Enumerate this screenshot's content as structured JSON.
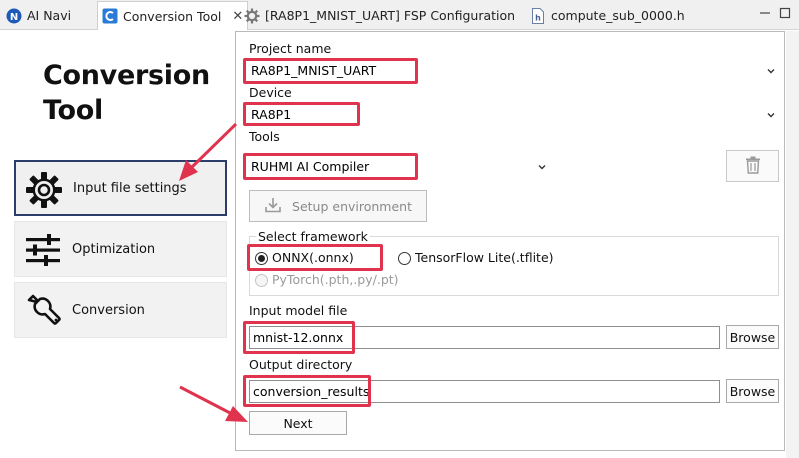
{
  "tabs": [
    {
      "label": "AI Navi",
      "icon": "ai-navi-icon"
    },
    {
      "label": "Conversion Tool",
      "icon": "conversion-tool-icon",
      "active": true
    },
    {
      "label": "[RA8P1_MNIST_UART] FSP Configuration",
      "icon": "gear-icon"
    },
    {
      "label": "compute_sub_0000.h",
      "icon": "header-file-icon"
    }
  ],
  "sidebar": {
    "title_line1": "Conversion",
    "title_line2": "Tool",
    "items": [
      {
        "label": "Input file settings",
        "icon": "gear-icon",
        "selected": true
      },
      {
        "label": "Optimization",
        "icon": "sliders-icon"
      },
      {
        "label": "Conversion",
        "icon": "wrench-icon"
      }
    ]
  },
  "form": {
    "project_name_label": "Project name",
    "project_name_value": "RA8P1_MNIST_UART",
    "device_label": "Device",
    "device_value": "RA8P1",
    "tools_label": "Tools",
    "tools_value": "RUHMI AI Compiler",
    "setup_button": "Setup environment",
    "framework_group_label": "Select framework",
    "framework_options": [
      {
        "label": "ONNX(.onnx)",
        "checked": true,
        "enabled": true
      },
      {
        "label": "TensorFlow Lite(.tflite)",
        "checked": false,
        "enabled": true
      },
      {
        "label": "PyTorch(.pth,.py/.pt)",
        "checked": false,
        "enabled": false
      }
    ],
    "input_model_label": "Input model file",
    "input_model_value": "mnist-12.onnx",
    "output_dir_label": "Output directory",
    "output_dir_value": "conversion_results",
    "browse_label": "Browse",
    "next_button": "Next"
  },
  "colors": {
    "highlight": "#e0334e",
    "selected_border": "#2b3d6b"
  }
}
